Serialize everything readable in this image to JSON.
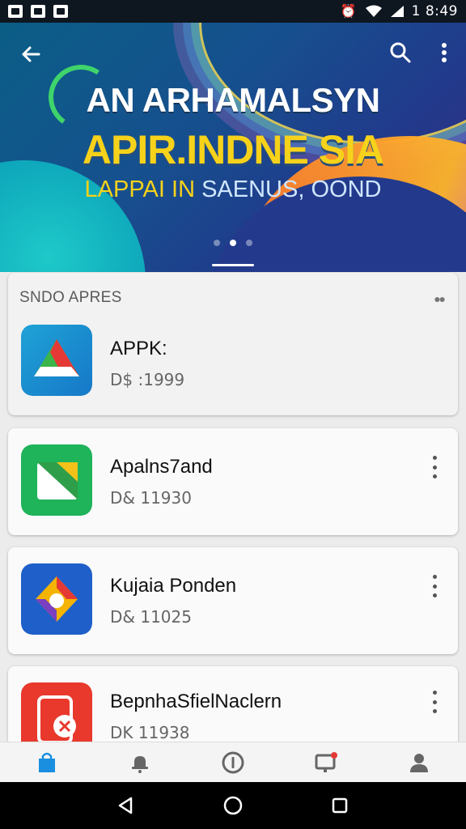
{
  "status_bar": {
    "time": "1 8:49"
  },
  "hero": {
    "line1": "AN ARHAMALSYN",
    "line2": "APIR.INDNE SIA",
    "line3_part1": "LAPPAI IN",
    "line3_part2": "SAENUS, OOND",
    "page_count": 3,
    "active_page": 2,
    "icons": {
      "back": "back-arrow-icon",
      "search": "search-icon",
      "more": "more-vert-icon"
    }
  },
  "section": {
    "title": "SNDO APRES",
    "app": {
      "name": "APPK:",
      "subtitle": "D$ :1999",
      "icon": "triangle-logo-icon"
    }
  },
  "apps": [
    {
      "name": "Apalns7and",
      "subtitle": "D& 11930",
      "icon": "green-folder-icon"
    },
    {
      "name": "Kujaia Ponden",
      "subtitle": "D& 11025",
      "icon": "colorful-drive-icon"
    },
    {
      "name": "BepnhaSfielNaclern",
      "subtitle": "DK 11938",
      "icon": "red-app-icon"
    }
  ],
  "colors": {
    "accent": "#1a8fe0",
    "hero_yellow": "#f6d21a",
    "nav_background": "#f4f4f4"
  },
  "bottom_nav": [
    {
      "icon": "store-bag-icon",
      "active": true
    },
    {
      "icon": "bell-icon",
      "active": false
    },
    {
      "icon": "info-circle-icon",
      "active": false
    },
    {
      "icon": "monitor-notification-icon",
      "active": false,
      "badge": true
    },
    {
      "icon": "profile-icon",
      "active": false
    }
  ],
  "system_nav": {
    "icons": [
      "back-triangle-icon",
      "home-circle-icon",
      "recents-square-icon"
    ]
  }
}
